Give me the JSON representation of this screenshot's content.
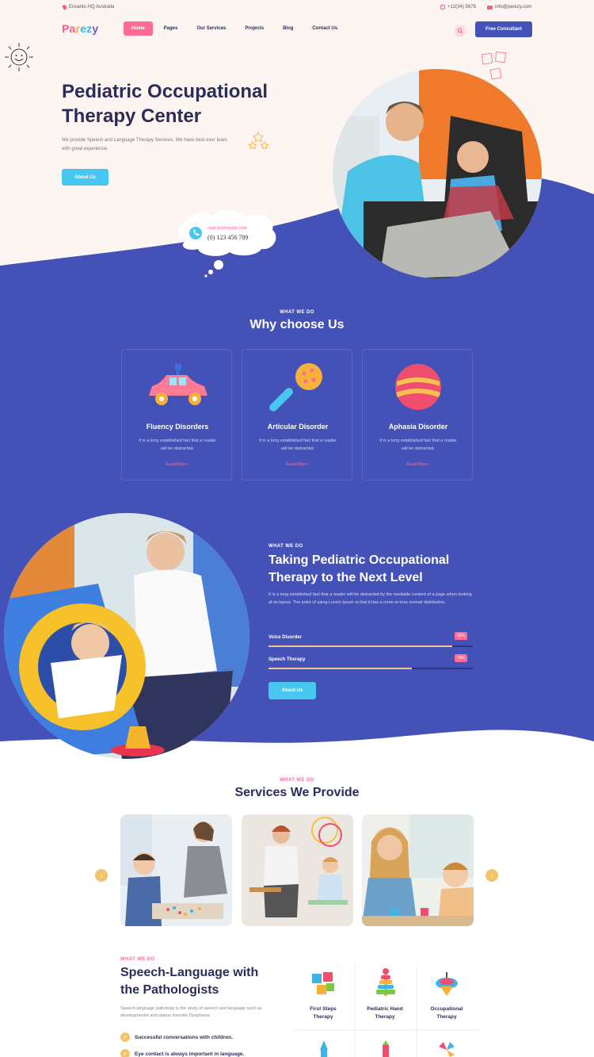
{
  "topbar": {
    "address": "Envanto HQ Australia",
    "phone": "+12(34) 5678",
    "email": "info@parezy.com"
  },
  "logo": {
    "text_1": "Pa",
    "text_2": "r",
    "text_3": "ez",
    "text_4": "y"
  },
  "nav": {
    "items": [
      "Home",
      "Pages",
      "Our Services",
      "Projects",
      "Blog",
      "Contact Us"
    ],
    "cta": "Free Consultant"
  },
  "hero": {
    "title_line1": "Pediatric Occupational",
    "title_line2": "Therapy Center",
    "text": "We provide Speech and Language Therapy Services. We have best ever team with great experience.",
    "button": "About Us",
    "bubble_email": "mail.dummysite.com",
    "bubble_phone": "(0) 123 456 789"
  },
  "why": {
    "eyebrow": "WHAT WE DO",
    "title": "Why choose Us",
    "cards": [
      {
        "title": "Fluency Disorders",
        "text": "It is a long established fact that a reader will be distracted.",
        "link": "Read More"
      },
      {
        "title": "Articular Disorder",
        "text": "It is a long established fact that a reader will be distracted.",
        "link": "Read More"
      },
      {
        "title": "Aphasia Disorder",
        "text": "It is a long established fact that a reader will be distracted.",
        "link": "Read More"
      }
    ]
  },
  "level": {
    "eyebrow": "WHAT WE DO",
    "title_line1": "Taking Pediatric Occupational",
    "title_line2": "Therapy to the Next Level",
    "text": "It is a long established fact that a reader will be distracted by the readable content of a page when looking at its layout. The point of using Lorem Ipsum is that it has a more-or-less normal distribution.",
    "skills": [
      {
        "label": "Voice Disorder",
        "badge": "90%",
        "value": 0.9
      },
      {
        "label": "Speech Therapy",
        "badge": "70%",
        "value": 0.7
      }
    ],
    "button": "About Us"
  },
  "services": {
    "eyebrow": "WHAT WE DO",
    "title": "Services We Provide",
    "prev": "‹",
    "next": "›"
  },
  "speech": {
    "eyebrow": "WHAT WE DO",
    "title_line1": "Speech-Language with",
    "title_line2": "the Pathologists",
    "text": "Speech-language pathology is the study of speech and language such as developmental articulation disorder Dysphasia.",
    "checks": [
      "Successful conversations with children.",
      "Eye contact is always important in language."
    ],
    "therapies": [
      {
        "line1": "First Steps",
        "line2": "Therapy"
      },
      {
        "line1": "Pediatric Hand",
        "line2": "Therapy"
      },
      {
        "line1": "Occupational",
        "line2": "Therapy"
      }
    ]
  },
  "colors": {
    "primary": "#4452b8",
    "accent": "#ff6b93",
    "cyan": "#47c6ef",
    "cream": "#fdf5f1"
  }
}
